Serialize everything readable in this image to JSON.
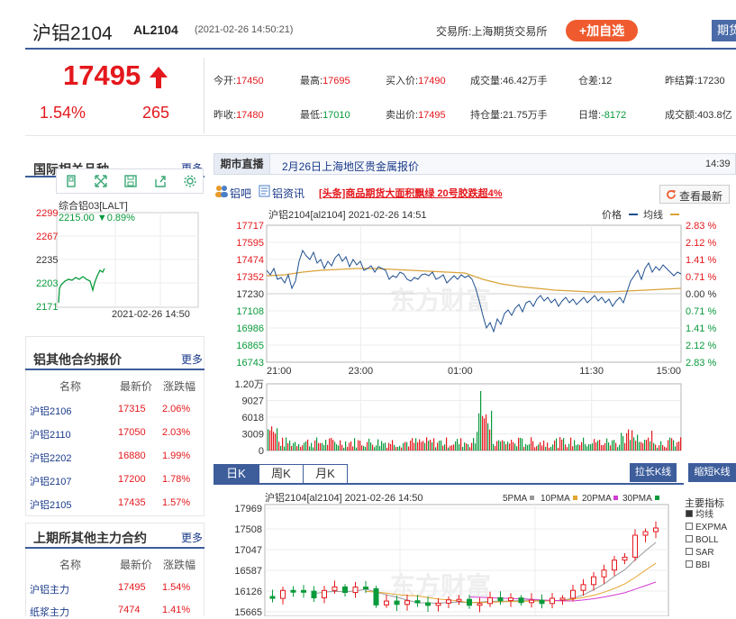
{
  "header": {
    "name": "沪铝2104",
    "code": "AL2104",
    "time": "(2021-02-26 14:50:21)",
    "exchange": "交易所:上海期货交易所",
    "add_favorite": "+加自选",
    "period": "期货"
  },
  "price": {
    "last": "17495",
    "pct": "1.54%",
    "change": "265"
  },
  "quote": {
    "open_label": "今开:",
    "open": "17450",
    "high_label": "最高:",
    "high": "17695",
    "bid_label": "买入价:",
    "bid": "17490",
    "volume_label": "成交量:",
    "volume": "46.42万手",
    "diff_label": "仓差:",
    "diff": "12",
    "prev_settle_label": "昨结算:",
    "prev_settle": "17230",
    "prev_close_label": "昨收:",
    "prev_close": "17480",
    "low_label": "最低:",
    "low": "17010",
    "ask_label": "卖出价:",
    "ask": "17495",
    "oi_label": "持仓量:",
    "oi": "21.75万手",
    "daily_inc_label": "日增:",
    "daily_inc": "-8172",
    "amount_label": "成交额:",
    "amount": "403.8亿"
  },
  "intl": {
    "title": "国际相关品种",
    "more": "更多",
    "index_name": "综合铝03[LALT]",
    "index_value": "2215.00",
    "index_change": "▼0.89%",
    "y_ticks": [
      "2299",
      "2267",
      "2235",
      "2203",
      "2171"
    ],
    "time": "2021-02-26 14:50"
  },
  "other_contracts": {
    "title": "铝其他合约报价",
    "more": "更多",
    "headers": [
      "名称",
      "最新价",
      "涨跌幅"
    ],
    "rows": [
      {
        "name": "沪铝2106",
        "price": "17315",
        "pct": "2.06%"
      },
      {
        "name": "沪铝2110",
        "price": "17050",
        "pct": "2.03%"
      },
      {
        "name": "沪铝2202",
        "price": "16880",
        "pct": "1.99%"
      },
      {
        "name": "沪铝2107",
        "price": "17200",
        "pct": "1.78%"
      },
      {
        "name": "沪铝2105",
        "price": "17435",
        "pct": "1.57%"
      }
    ]
  },
  "main_contracts": {
    "title": "上期所其他主力合约",
    "more": "更多",
    "headers": [
      "名称",
      "最新价",
      "涨跌幅"
    ],
    "rows": [
      {
        "name": "沪铝主力",
        "price": "17495",
        "pct": "1.54%"
      },
      {
        "name": "纸浆主力",
        "price": "7474",
        "pct": "1.41%"
      }
    ]
  },
  "ticker": {
    "label": "期市直播",
    "text": "2月26日上海地区贵金属报价",
    "time": "14:39"
  },
  "links": {
    "bar": "铝吧",
    "news": "铝资讯",
    "headline": "[头条]商品期货大面积飘绿 20号胶跌超4%",
    "refresh": "查看最新"
  },
  "intraday": {
    "title": "沪铝2104[al2104] 2021-02-26 14:51",
    "legend_price": "价格",
    "legend_avg": "均线",
    "y_ticks": [
      "17717",
      "17595",
      "17474",
      "17352",
      "17230",
      "17108",
      "16986",
      "16865",
      "16743"
    ],
    "pct_ticks": [
      "2.83 %",
      "2.12 %",
      "1.41 %",
      "0.71 %",
      "0.00 %",
      "0.71 %",
      "1.41 %",
      "2.12 %",
      "2.83 %"
    ],
    "x_ticks": [
      "21:00",
      "23:00",
      "01:00",
      "11:30",
      "15:00"
    ],
    "vol_ticks": [
      "1.20万",
      "9027",
      "6018",
      "3009",
      "0"
    ],
    "watermark": "东方财富"
  },
  "kline": {
    "tabs": [
      "日K",
      "周K",
      "月K"
    ],
    "stretch": "拉长K线",
    "shorten": "缩短K线",
    "title": "沪铝2104[al2104] 2021-02-26 14:50",
    "ma": [
      "5PMA",
      "10PMA",
      "20PMA",
      "30PMA"
    ],
    "y_ticks": [
      "17969",
      "17508",
      "17047",
      "16587",
      "16126",
      "15665"
    ],
    "indicator_title": "主要指标",
    "indicators": [
      "均线",
      "EXPMA",
      "BOLL",
      "SAR",
      "BBI"
    ],
    "watermark": "东方财富"
  },
  "colors": {
    "up": "#e4181d",
    "down": "#089a3b",
    "accent": "#3d5d9b",
    "orange": "#ef5b2f"
  }
}
